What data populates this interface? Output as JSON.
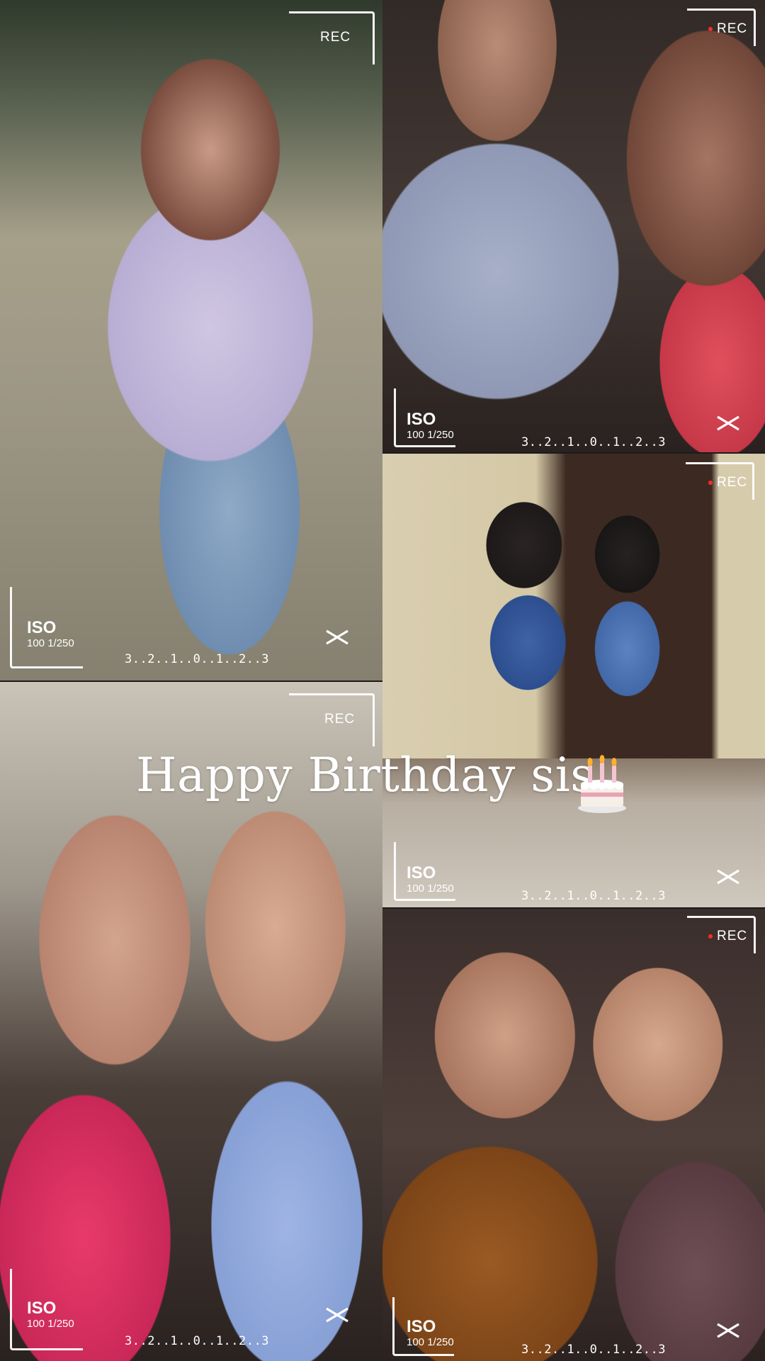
{
  "overlay": {
    "rec_label": "REC",
    "iso_label": "ISO",
    "iso_values": "100 1/250",
    "exposure_scale": "3..2..1..0..1..2..3"
  },
  "title": {
    "text": "Happy Birthday sis"
  },
  "tiles": [
    {
      "id": "tile-1",
      "photo": "woman in lavender top on sidewalk"
    },
    {
      "id": "tile-2",
      "photo": "selfie two women, light blue and red tops"
    },
    {
      "id": "tile-3",
      "photo": "two women standing in front of door"
    },
    {
      "id": "tile-4",
      "photo": "selfie two women, pink and blue tops"
    },
    {
      "id": "tile-5",
      "photo": "selfie two women, brown and mauve tops"
    }
  ],
  "icons": {
    "capcut": "capcut-logo-icon",
    "cake": "birthday-cake-icon"
  },
  "colors": {
    "overlay_white": "#ffffff",
    "rec_dot": "#ff2a2a"
  }
}
